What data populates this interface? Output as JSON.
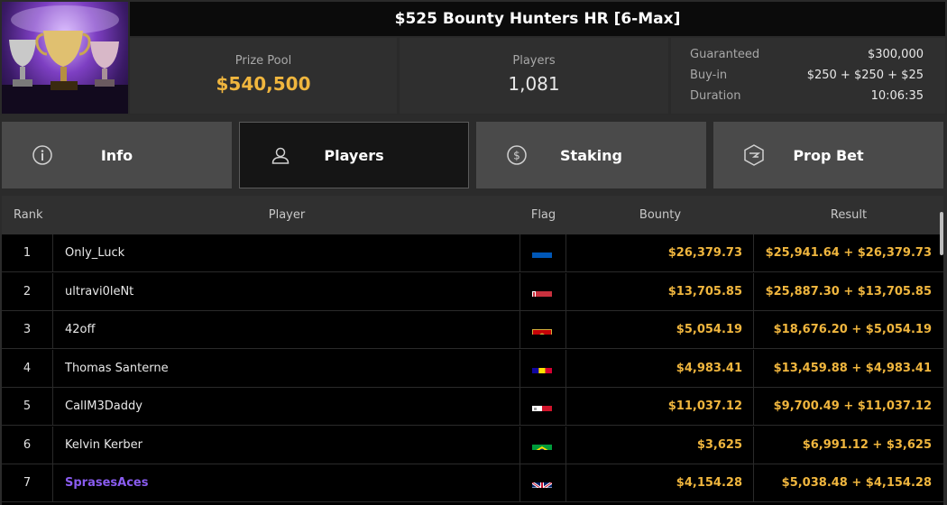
{
  "tournament": {
    "title": "$525 Bounty Hunters HR [6-Max]",
    "prize_pool_label": "Prize Pool",
    "prize_pool_value": "$540,500",
    "players_label": "Players",
    "players_value": "1,081",
    "details": [
      {
        "key": "Guaranteed",
        "value": "$300,000"
      },
      {
        "key": "Buy-in",
        "value": "$250 + $250 + $25"
      },
      {
        "key": "Duration",
        "value": "10:06:35"
      }
    ]
  },
  "tabs": [
    {
      "label": "Info",
      "icon": "info-icon"
    },
    {
      "label": "Players",
      "icon": "user-icon",
      "active": true
    },
    {
      "label": "Staking",
      "icon": "dollar-coin-icon"
    },
    {
      "label": "Prop Bet",
      "icon": "bolt-hexagon-icon"
    }
  ],
  "table": {
    "columns": {
      "rank": "Rank",
      "player": "Player",
      "flag": "Flag",
      "bounty": "Bounty",
      "result": "Result"
    },
    "rows": [
      {
        "rank": "1",
        "player": "Only_Luck",
        "flag": "ukraine",
        "bounty": "$26,379.73",
        "result": "$25,941.64 + $26,379.73"
      },
      {
        "rank": "2",
        "player": "ultravi0leNt",
        "flag": "belarus",
        "bounty": "$13,705.85",
        "result": "$25,887.30 + $13,705.85"
      },
      {
        "rank": "3",
        "player": "42off",
        "flag": "montenegro",
        "bounty": "$5,054.19",
        "result": "$18,676.20 + $5,054.19"
      },
      {
        "rank": "4",
        "player": "Thomas Santerne",
        "flag": "andorra",
        "bounty": "$4,983.41",
        "result": "$13,459.88 + $4,983.41"
      },
      {
        "rank": "5",
        "player": "CallM3Daddy",
        "flag": "malta",
        "bounty": "$11,037.12",
        "result": "$9,700.49 + $11,037.12"
      },
      {
        "rank": "6",
        "player": "Kelvin Kerber",
        "flag": "brazil",
        "bounty": "$3,625",
        "result": "$6,991.12 + $3,625"
      },
      {
        "rank": "7",
        "player": "SprasesAces",
        "flag": "united-kingdom",
        "bounty": "$4,154.28",
        "result": "$5,038.48 + $4,154.28",
        "highlight": true
      }
    ]
  },
  "colors": {
    "accent_gold": "#f0b63e",
    "highlight_purple": "#8a5cf0"
  }
}
